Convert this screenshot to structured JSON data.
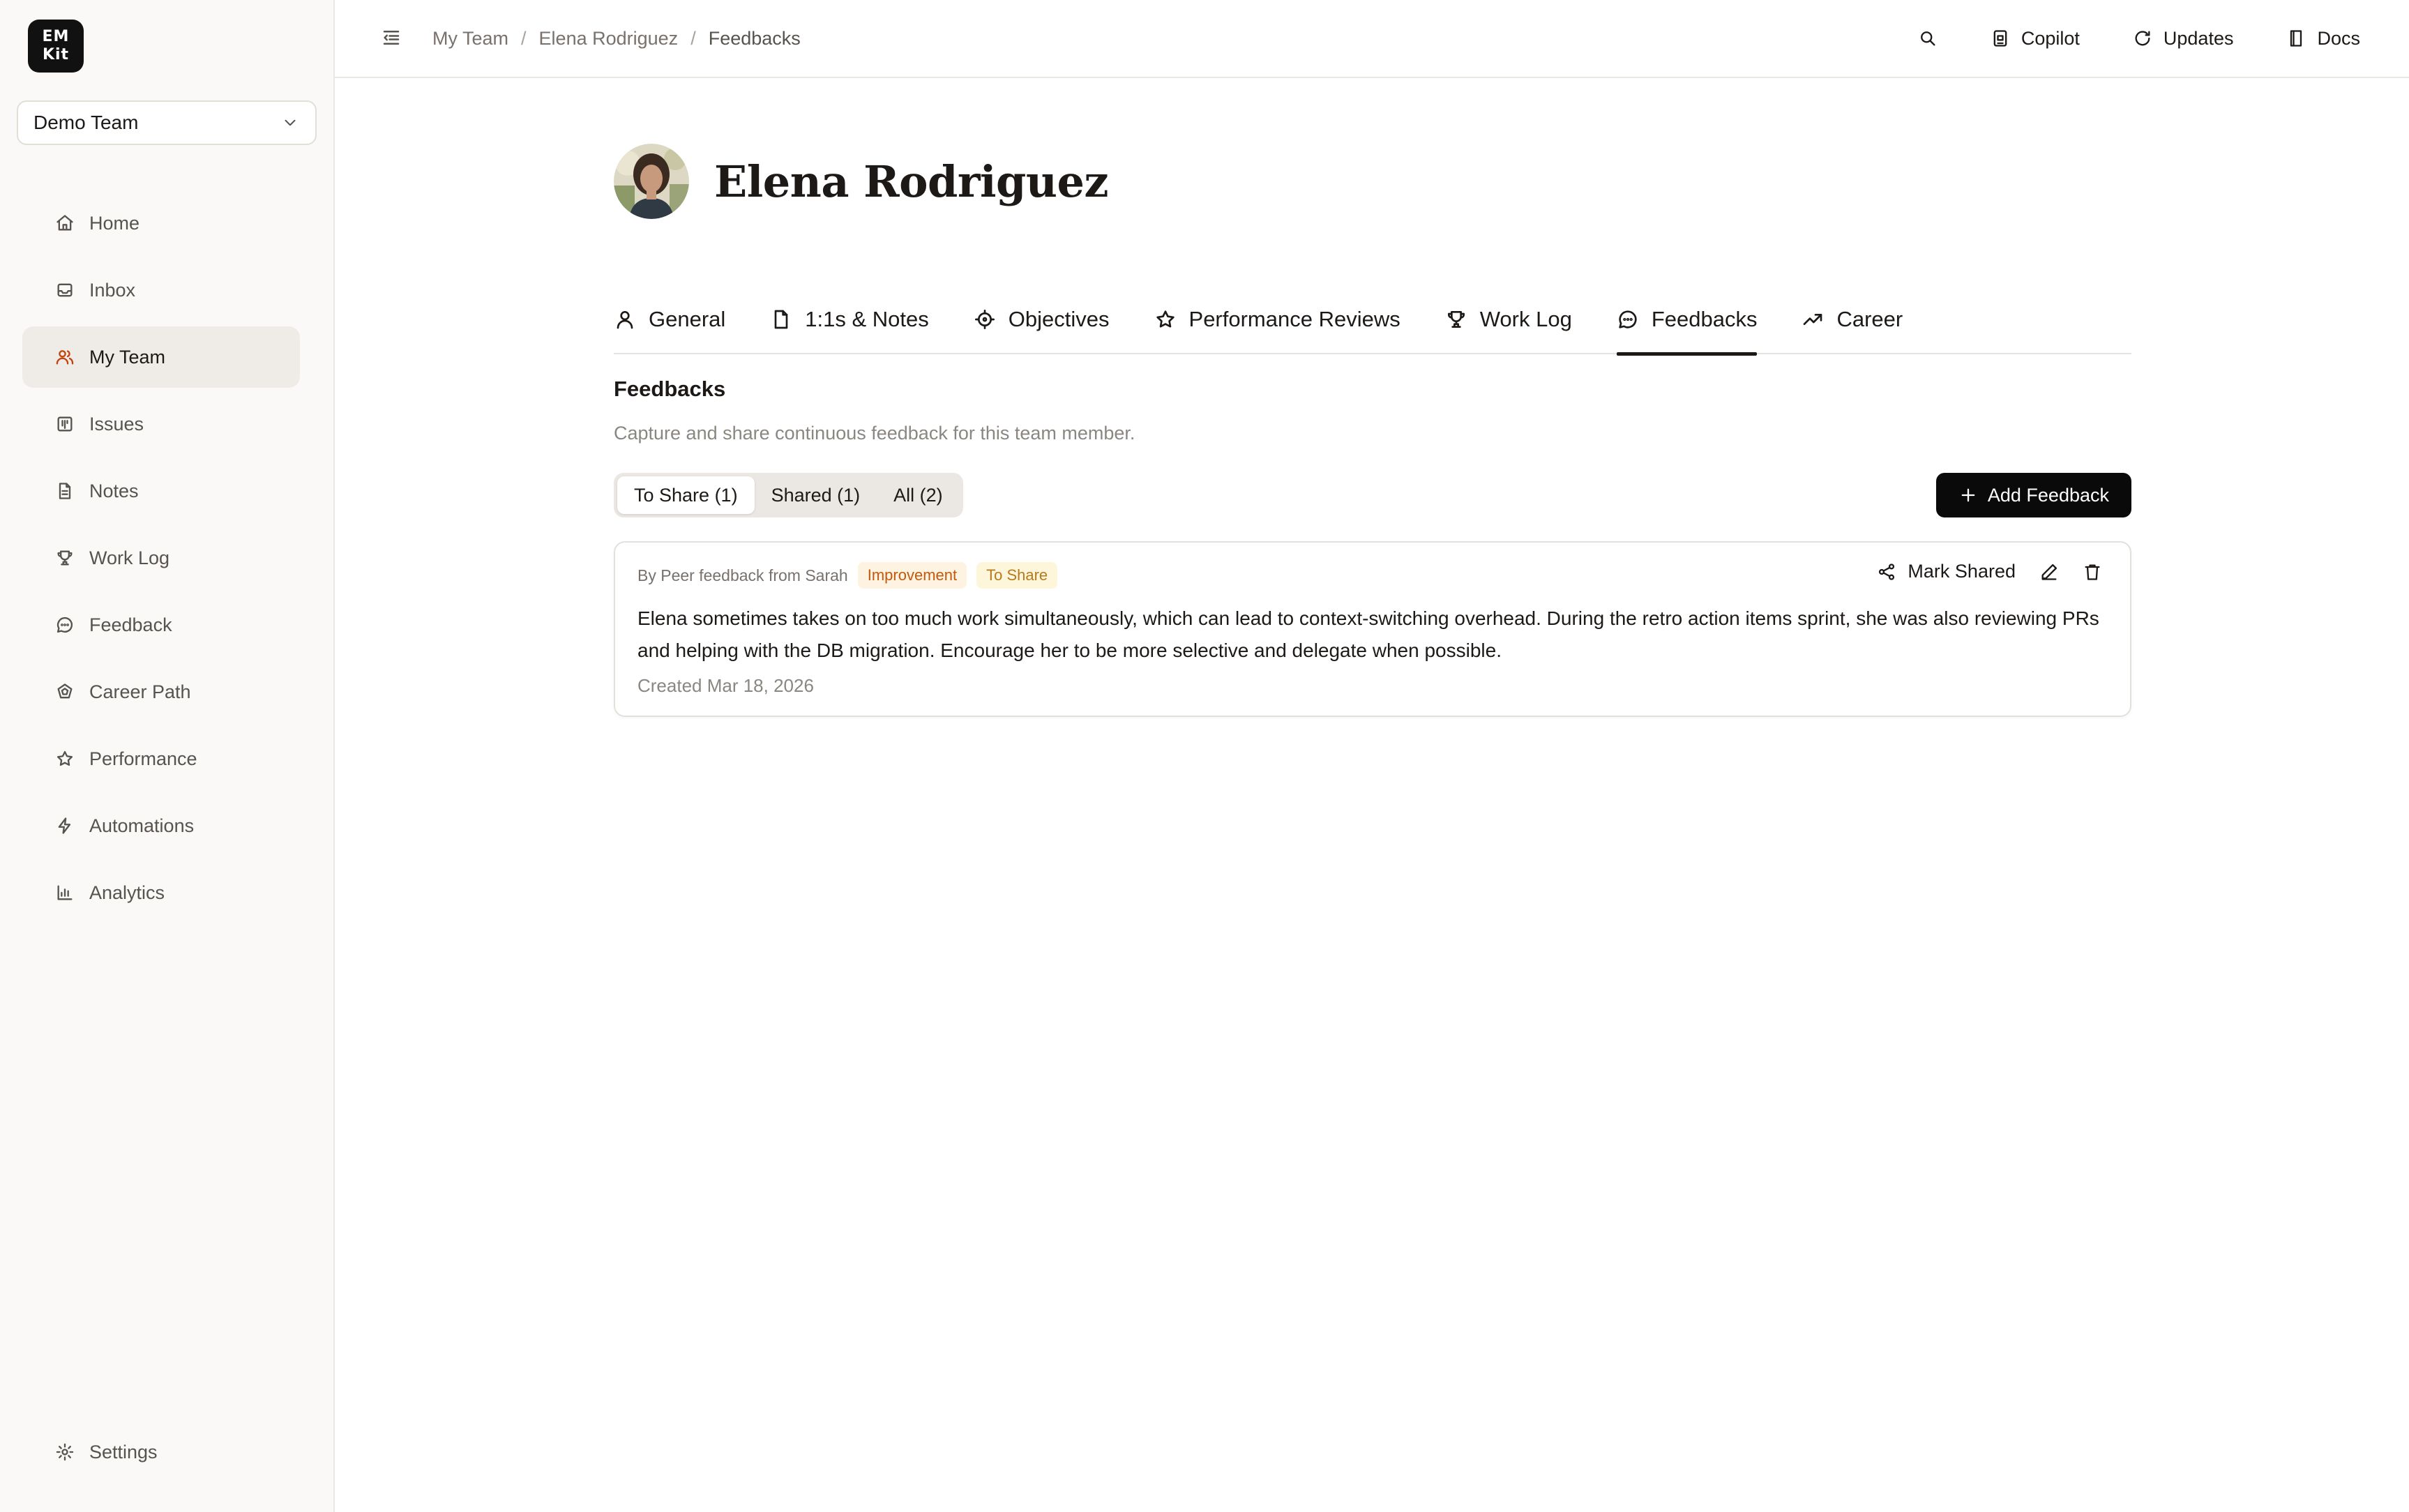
{
  "app": {
    "logo_text": "EM Kit",
    "logo_line1": "EM",
    "logo_line2": "Kit"
  },
  "team_selector": {
    "value": "Demo Team"
  },
  "sidebar": {
    "items": [
      {
        "label": "Home",
        "icon": "home-icon",
        "active": false
      },
      {
        "label": "Inbox",
        "icon": "inbox-icon",
        "active": false
      },
      {
        "label": "My Team",
        "icon": "users-icon",
        "active": true
      },
      {
        "label": "Issues",
        "icon": "kanban-icon",
        "active": false
      },
      {
        "label": "Notes",
        "icon": "file-text-icon",
        "active": false
      },
      {
        "label": "Work Log",
        "icon": "trophy-icon",
        "active": false
      },
      {
        "label": "Feedback",
        "icon": "message-circle-icon",
        "active": false
      },
      {
        "label": "Career Path",
        "icon": "career-path-icon",
        "active": false
      },
      {
        "label": "Performance",
        "icon": "star-icon",
        "active": false
      },
      {
        "label": "Automations",
        "icon": "zap-icon",
        "active": false
      },
      {
        "label": "Analytics",
        "icon": "bar-chart-icon",
        "active": false
      }
    ],
    "settings_label": "Settings"
  },
  "breadcrumb": {
    "items": [
      "My Team",
      "Elena Rodriguez",
      "Feedbacks"
    ],
    "separator": "/"
  },
  "topbar": {
    "copilot": "Copilot",
    "updates": "Updates",
    "docs": "Docs"
  },
  "profile": {
    "name": "Elena Rodriguez"
  },
  "tabs": [
    {
      "label": "General",
      "icon": "user-icon",
      "active": false
    },
    {
      "label": "1:1s & Notes",
      "icon": "file-icon",
      "active": false
    },
    {
      "label": "Objectives",
      "icon": "target-icon",
      "active": false
    },
    {
      "label": "Performance Reviews",
      "icon": "star-icon",
      "active": false
    },
    {
      "label": "Work Log",
      "icon": "trophy-icon",
      "active": false
    },
    {
      "label": "Feedbacks",
      "icon": "message-circle-icon",
      "active": true
    },
    {
      "label": "Career",
      "icon": "trending-up-icon",
      "active": false
    }
  ],
  "section": {
    "title": "Feedbacks",
    "description": "Capture and share continuous feedback for this team member."
  },
  "filters": [
    {
      "label": "To Share (1)",
      "active": true
    },
    {
      "label": "Shared (1)",
      "active": false
    },
    {
      "label": "All (2)",
      "active": false
    }
  ],
  "add_button": "Add Feedback",
  "feedback": {
    "by": "By Peer feedback from Sarah",
    "badges": [
      "Improvement",
      "To Share"
    ],
    "mark_shared": "Mark Shared",
    "body": "Elena sometimes takes on too much work simultaneously, which can lead to context-switching overhead. During the retro action items sprint, she was also reviewing PRs and helping with the DB migration. Encourage her to be more selective and delegate when possible.",
    "created": "Created Mar 18, 2026"
  },
  "colors": {
    "accent": "#c2410c",
    "primary_button": "#0a0a0a",
    "sidebar_bg": "#faf9f7",
    "badge_improvement": "#c2590c",
    "badge_to_share": "#b7791f"
  }
}
